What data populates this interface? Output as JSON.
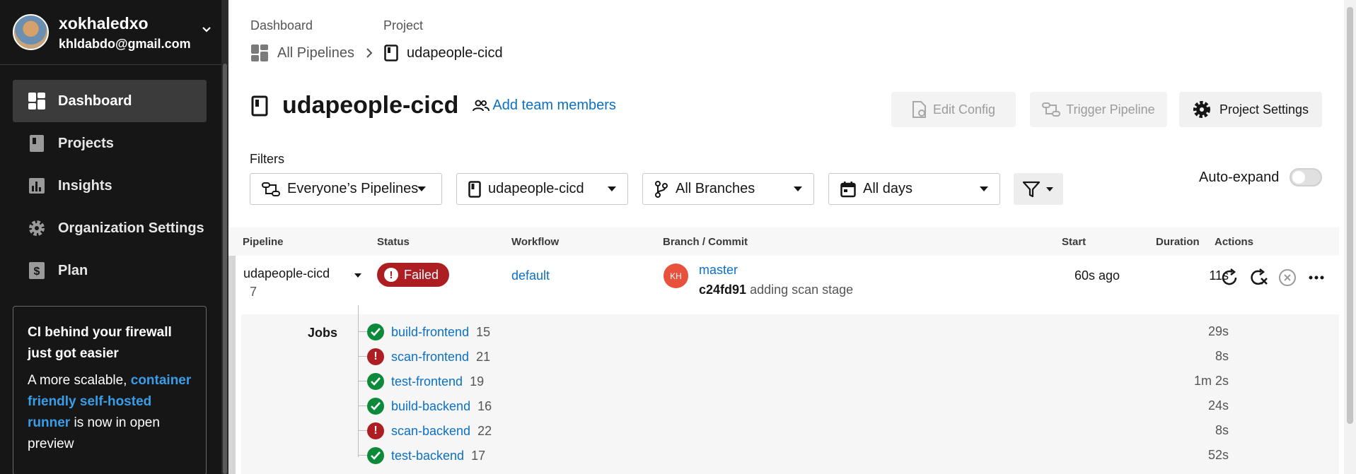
{
  "user": {
    "name": "xokhaledxo",
    "email": "khldabdo@gmail.com"
  },
  "sidebar": {
    "items": [
      {
        "label": "Dashboard",
        "icon": "dashboard-icon",
        "active": true
      },
      {
        "label": "Projects",
        "icon": "book-icon"
      },
      {
        "label": "Insights",
        "icon": "chart-icon"
      },
      {
        "label": "Organization Settings",
        "icon": "gear-icon"
      },
      {
        "label": "Plan",
        "icon": "dollar-icon"
      }
    ],
    "promo": {
      "title": "CI behind your firewall just got easier",
      "text_before": "A more scalable, ",
      "link": "container friendly self-hosted runner",
      "text_after": " is now in open preview"
    }
  },
  "breadcrumb": {
    "level1_label": "Dashboard",
    "level2_label": "Project",
    "level1_value": "All Pipelines",
    "level2_value": "udapeople-cicd"
  },
  "project": {
    "title": "udapeople-cicd",
    "add_team": "Add team members",
    "edit_config": "Edit Config",
    "trigger_pipeline": "Trigger Pipeline",
    "project_settings": "Project Settings"
  },
  "filters": {
    "label": "Filters",
    "pipelines": "Everyone’s Pipelines",
    "project": "udapeople-cicd",
    "branches": "All Branches",
    "days": "All days",
    "auto_expand": "Auto-expand",
    "auto_expand_on": false
  },
  "table": {
    "headers": [
      "Pipeline",
      "Status",
      "Workflow",
      "Branch / Commit",
      "Start",
      "Duration",
      "Actions"
    ],
    "pipeline": {
      "name": "udapeople-cicd",
      "number": "7",
      "status": "Failed",
      "workflow": "default",
      "avatar": "KH",
      "branch": "master",
      "commit_hash": "c24fd91",
      "commit_msg": "adding scan stage",
      "start": "60s ago",
      "duration": "11s"
    },
    "jobs_label": "Jobs",
    "jobs": [
      {
        "name": "build-frontend",
        "num": "15",
        "status": "success",
        "duration": "29s"
      },
      {
        "name": "scan-frontend",
        "num": "21",
        "status": "failed",
        "duration": "8s"
      },
      {
        "name": "test-frontend",
        "num": "19",
        "status": "success",
        "duration": "1m 2s"
      },
      {
        "name": "build-backend",
        "num": "16",
        "status": "success",
        "duration": "24s"
      },
      {
        "name": "scan-backend",
        "num": "22",
        "status": "failed",
        "duration": "8s"
      },
      {
        "name": "test-backend",
        "num": "17",
        "status": "success",
        "duration": "52s"
      }
    ]
  },
  "colors": {
    "sidebar_bg": "#161616",
    "link": "#0c70c4",
    "failed": "#ad1e23",
    "success": "#0c8a3a",
    "promo_link": "#3a9de8"
  }
}
